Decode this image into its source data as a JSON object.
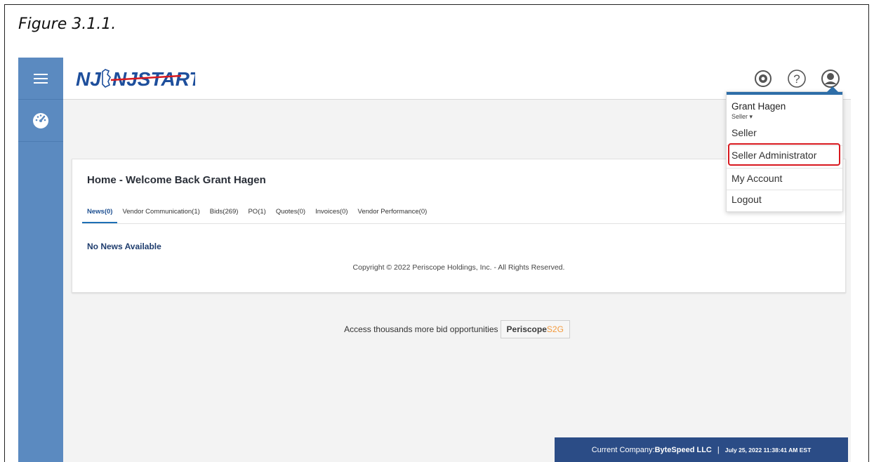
{
  "caption": "Figure 3.1.1.",
  "app": {
    "logo_text": "NJSTART",
    "rail": {
      "menu_icon": "hamburger-icon",
      "dashboard_icon": "dashboard-icon"
    },
    "top_icons": [
      "gear-icon",
      "help-icon",
      "user-icon"
    ]
  },
  "home": {
    "title": "Home - Welcome Back Grant Hagen",
    "tabs": [
      {
        "label": "News(0)",
        "active": true
      },
      {
        "label": "Vendor Communication(1)",
        "active": false
      },
      {
        "label": "Bids(269)",
        "active": false
      },
      {
        "label": "PO(1)",
        "active": false
      },
      {
        "label": "Quotes(0)",
        "active": false
      },
      {
        "label": "Invoices(0)",
        "active": false
      },
      {
        "label": "Vendor Performance(0)",
        "active": false
      }
    ],
    "no_news": "No News Available",
    "copyright": "Copyright © 2022 Periscope Holdings, Inc. - All Rights Reserved."
  },
  "promo": {
    "text": "Access thousands more bid opportunities",
    "button_primary": "Periscope",
    "button_accent": "S2G"
  },
  "user_menu": {
    "name": "Grant Hagen",
    "role_selector": "Seller ▾",
    "items": [
      "Seller",
      "Seller Administrator",
      "My Account",
      "Logout"
    ],
    "highlighted": "Seller Administrator"
  },
  "footer": {
    "company_label": "Current Company: ",
    "company_name": "ByteSpeed LLC",
    "separator": "|",
    "datetime": "July 25, 2022 11:38:41 AM EST"
  },
  "colors": {
    "rail": "#5b8ac0",
    "footer": "#2b4c86",
    "highlight": "#d8191f",
    "accent_orange": "#f39a3d"
  }
}
